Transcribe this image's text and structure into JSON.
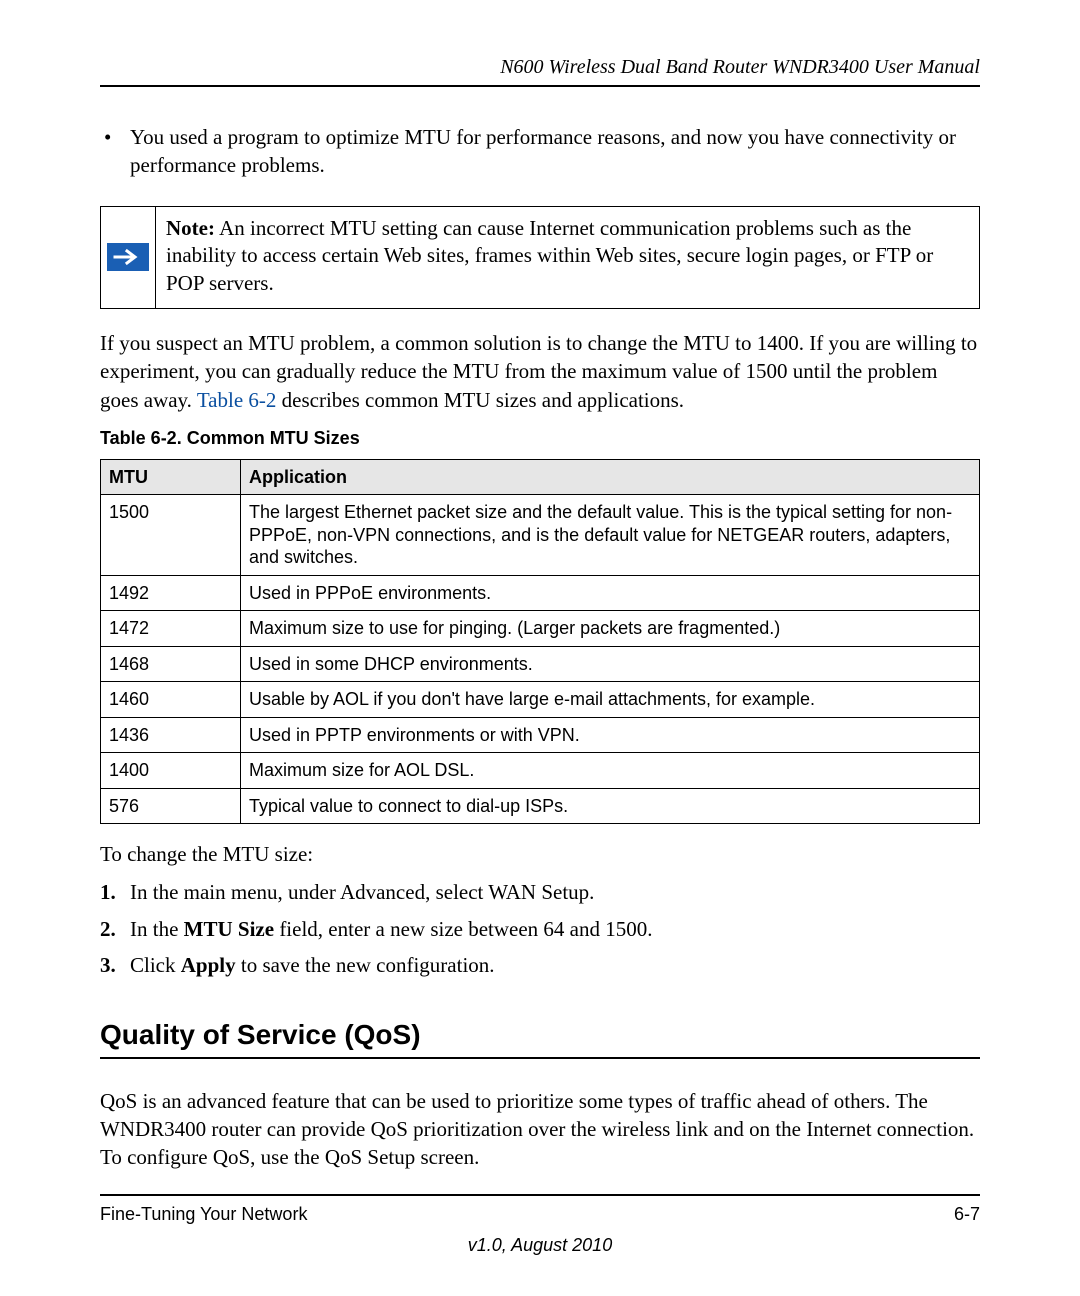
{
  "header": {
    "title": "N600 Wireless Dual Band Router WNDR3400 User Manual"
  },
  "bullet": "You used a program to optimize MTU for performance reasons, and now you have connectivity or performance problems.",
  "note": {
    "label": "Note:",
    "text": " An incorrect MTU setting can cause Internet communication problems such as the inability to access certain Web sites, frames within Web sites, secure login pages, or FTP or POP servers."
  },
  "para1_a": "If you suspect an MTU problem, a common solution is to change the MTU to 1400. If you are willing to experiment, you can gradually reduce the MTU from the maximum value of 1500 until the problem goes away. ",
  "para1_link": "Table 6-2",
  "para1_b": " describes common MTU sizes and applications.",
  "table": {
    "caption": "Table 6-2.  Common MTU Sizes ",
    "headers": {
      "mtu": "MTU",
      "app": "Application"
    },
    "rows": [
      {
        "mtu": "1500",
        "app": "The largest Ethernet packet size and the default value. This is the typical setting for non-PPPoE, non-VPN connections, and is the default value for NETGEAR routers, adapters, and switches."
      },
      {
        "mtu": "1492",
        "app": "Used in PPPoE environments."
      },
      {
        "mtu": "1472",
        "app": "Maximum size to use for pinging. (Larger packets are fragmented.)"
      },
      {
        "mtu": "1468",
        "app": "Used in some DHCP environments."
      },
      {
        "mtu": "1460",
        "app": "Usable by AOL if you don't have large e-mail attachments, for example."
      },
      {
        "mtu": "1436",
        "app": "Used in PPTP environments or with VPN."
      },
      {
        "mtu": "1400",
        "app": "Maximum size for AOL DSL."
      },
      {
        "mtu": "576",
        "app": "Typical value to connect to dial-up ISPs."
      }
    ]
  },
  "intro": "To change the MTU size:",
  "steps": {
    "s1": "In the main menu, under Advanced, select WAN Setup.",
    "s2a": "In the ",
    "s2b": "MTU Size",
    "s2c": " field, enter a new size between 64 and 1500.",
    "s3a": "Click ",
    "s3b": "Apply",
    "s3c": " to save the new configuration."
  },
  "section_heading": "Quality of Service (QoS)",
  "qos_para": "QoS is an advanced feature that can be used to prioritize some types of traffic ahead of others. The WNDR3400 router can provide QoS prioritization over the wireless link and on the Internet connection. To configure QoS, use the QoS Setup screen.",
  "footer": {
    "left": "Fine-Tuning Your Network",
    "right": "6-7",
    "version": "v1.0, August 2010"
  }
}
